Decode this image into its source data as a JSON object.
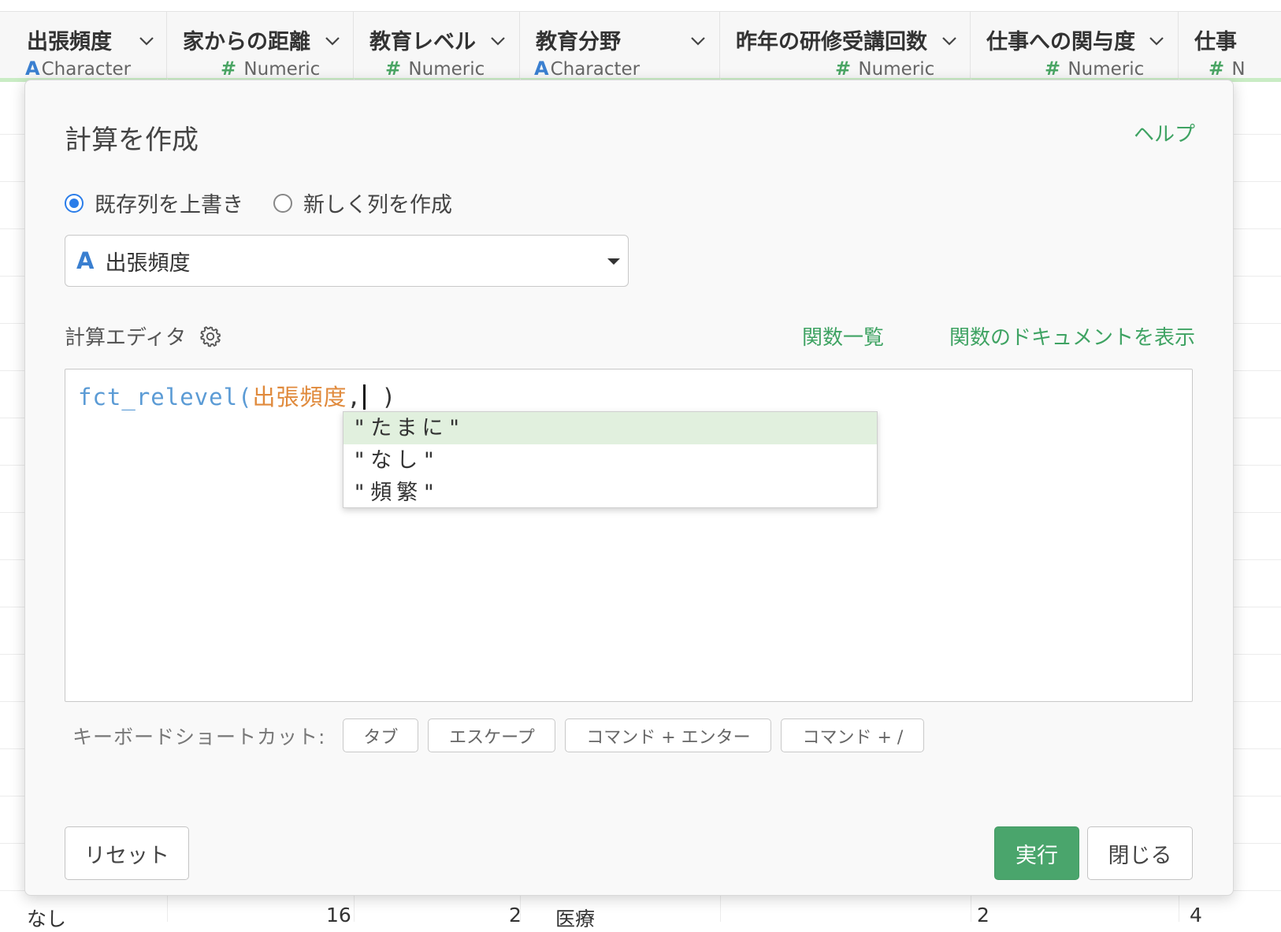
{
  "columns": [
    {
      "name": "出張頻度",
      "type": "Character",
      "type_icon": "A"
    },
    {
      "name": "家からの距離",
      "type": "Numeric",
      "type_icon": "#"
    },
    {
      "name": "教育レベル",
      "type": "Numeric",
      "type_icon": "#"
    },
    {
      "name": "教育分野",
      "type": "Character",
      "type_icon": "A"
    },
    {
      "name": "昨年の研修受講回数",
      "type": "Numeric",
      "type_icon": "#"
    },
    {
      "name": "仕事への関与度",
      "type": "Numeric",
      "type_icon": "#"
    },
    {
      "name": "仕事",
      "type": "N",
      "type_icon": "#"
    }
  ],
  "bottom_row": [
    "なし",
    "16",
    "2",
    "医療",
    "2",
    "4"
  ],
  "dialog": {
    "title": "計算を作成",
    "help_label": "ヘルプ",
    "radio_overwrite": "既存列を上書き",
    "radio_new": "新しく列を作成",
    "selected_column_icon": "A",
    "selected_column": "出張頻度",
    "editor_label": "計算エディタ",
    "fn_list_label": "関数一覧",
    "fn_doc_label": "関数のドキュメントを表示",
    "code": {
      "fn": "fct_relevel",
      "open": "(",
      "arg": "出張頻度",
      "comma": ",",
      "close": " )"
    },
    "autocomplete": [
      "\"たまに\"",
      "\"なし\"",
      "\"頻繁\""
    ],
    "shortcuts_label": "キーボードショートカット:",
    "shortcuts": [
      "タブ",
      "エスケープ",
      "コマンド + エンター",
      "コマンド + /"
    ],
    "reset_label": "リセット",
    "run_label": "実行",
    "close_label": "閉じる"
  },
  "colors": {
    "accent_green": "#4aa56c",
    "link_green": "#3fa363",
    "character_blue": "#3a7fd0",
    "numeric_green": "#4aa564",
    "radio_blue": "#2b7de9",
    "column_orange": "#e08a3c"
  }
}
